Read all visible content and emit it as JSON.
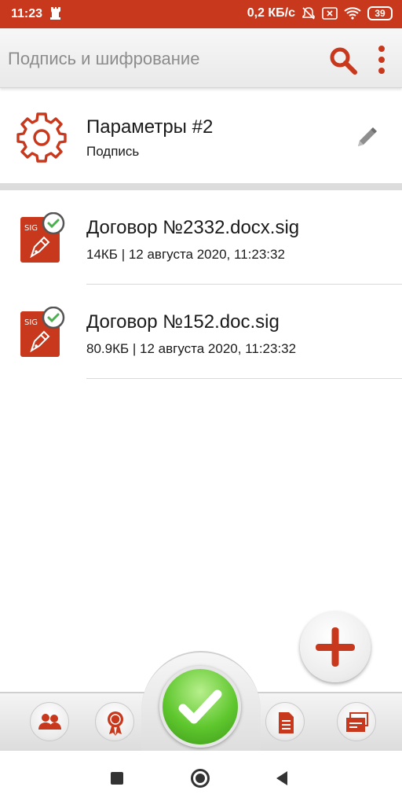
{
  "status_bar": {
    "time": "11:23",
    "speed": "0,2 КБ/с",
    "battery": "39"
  },
  "app_bar": {
    "title": "Подпись и шифрование",
    "search_icon": "search-icon",
    "menu_icon": "more-vert-icon"
  },
  "params": {
    "title": "Параметры #2",
    "subtitle": "Подпись",
    "icon": "gear-icon",
    "edit_icon": "pencil-icon"
  },
  "files": [
    {
      "name": "Договор №2332.docx.sig",
      "meta": "14КБ | 12 августа 2020, 11:23:32",
      "icon": "signed-file-icon",
      "badge": "SIG"
    },
    {
      "name": "Договор №152.doc.sig",
      "meta": "80.9КБ | 12 августа 2020, 11:23:32",
      "icon": "signed-file-icon",
      "badge": "SIG"
    }
  ],
  "toolbar": {
    "buttons": [
      "contacts-icon",
      "certificate-icon",
      "confirm-check-icon",
      "document-icon",
      "windows-icon"
    ]
  },
  "colors": {
    "accent": "#c8381c",
    "confirm": "#5fc72e",
    "check_badge": "#4caf50"
  }
}
